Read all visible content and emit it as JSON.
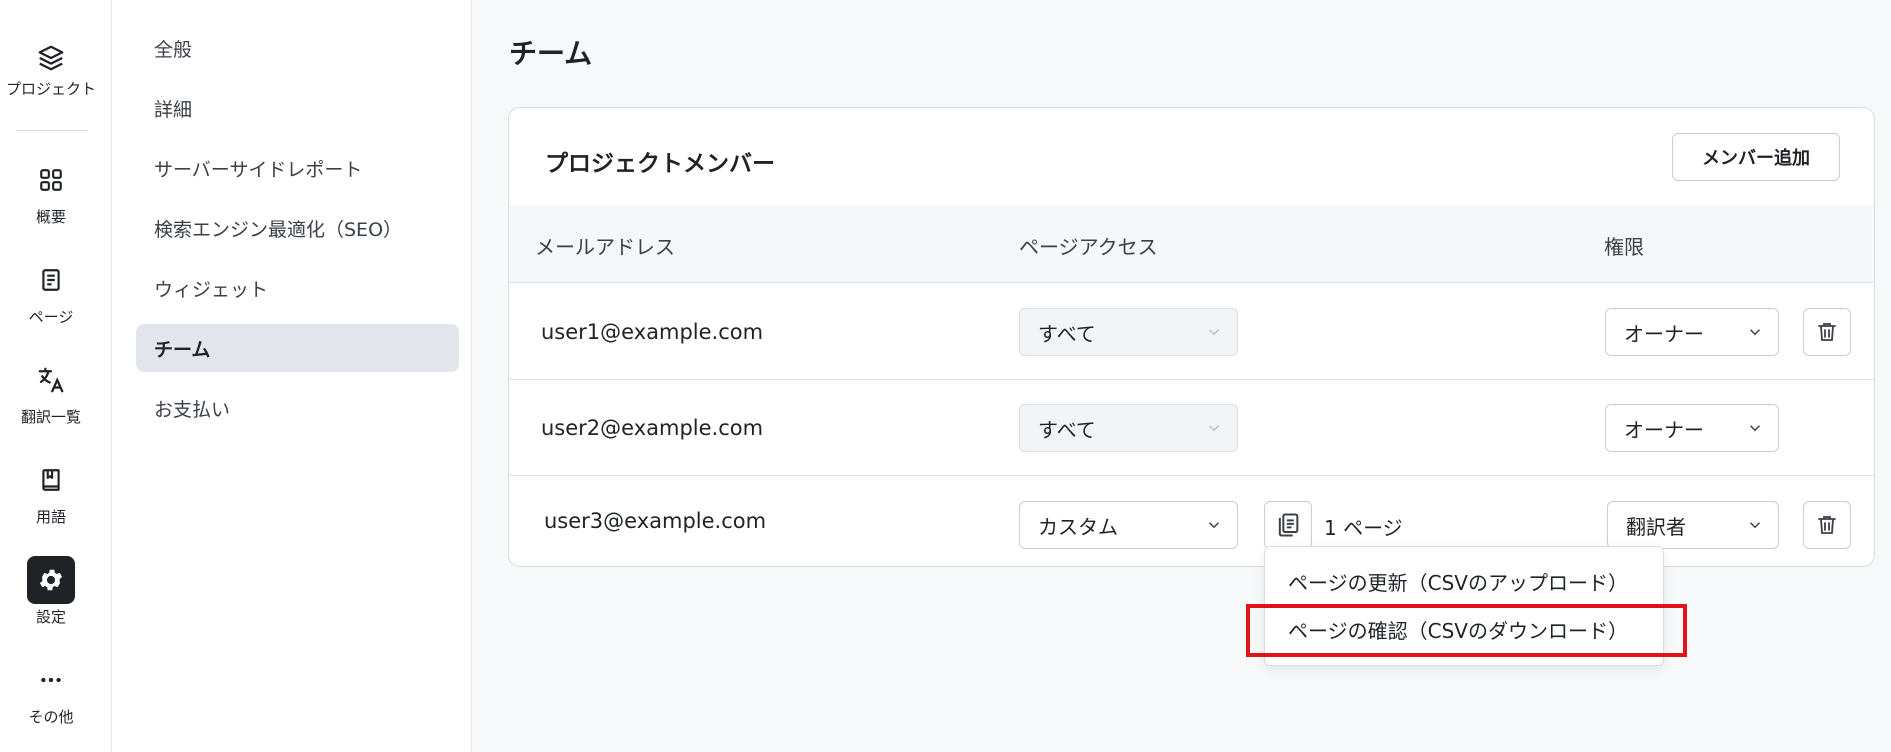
{
  "rail": {
    "items": [
      {
        "label": "プロジェクト",
        "icon": "layers-icon"
      },
      {
        "label": "概要",
        "icon": "grid-icon"
      },
      {
        "label": "ページ",
        "icon": "document-icon"
      },
      {
        "label": "翻訳一覧",
        "icon": "translate-icon"
      },
      {
        "label": "用語",
        "icon": "book-icon"
      },
      {
        "label": "設定",
        "icon": "gear-icon",
        "active": true
      },
      {
        "label": "その他",
        "icon": "more-icon"
      }
    ]
  },
  "subnav": {
    "items": [
      {
        "label": "全般"
      },
      {
        "label": "詳細"
      },
      {
        "label": "サーバーサイドレポート"
      },
      {
        "label": "検索エンジン最適化（SEO）"
      },
      {
        "label": "ウィジェット"
      },
      {
        "label": "チーム",
        "active": true
      },
      {
        "label": "お支払い"
      }
    ]
  },
  "main": {
    "title": "チーム",
    "card": {
      "title": "プロジェクトメンバー",
      "add_button": "メンバー追加",
      "columns": {
        "email": "メールアドレス",
        "page_access": "ページアクセス",
        "role": "権限"
      },
      "rows": [
        {
          "email": "user1@example.com",
          "page_access": "すべて",
          "role": "オーナー"
        },
        {
          "email": "user2@example.com",
          "page_access": "すべて",
          "role": "オーナー"
        },
        {
          "email": "user3@example.com",
          "page_access": "カスタム",
          "page_count": "1 ページ",
          "role": "翻訳者"
        }
      ]
    },
    "menu": {
      "items": [
        {
          "label": "ページの更新（CSVのアップロード）"
        },
        {
          "label": "ページの確認（CSVのダウンロード）"
        }
      ]
    }
  },
  "colors": {
    "highlight": "#e0131b",
    "active_nav_bg": "#e2e6ec",
    "active_rail_bg": "#1f2328"
  }
}
